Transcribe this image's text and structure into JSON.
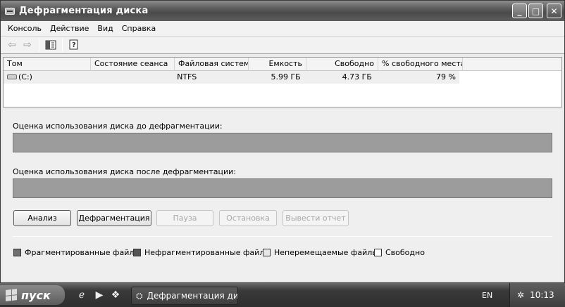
{
  "window": {
    "title": "Дефрагментация диска",
    "buttons": {
      "minimize": "_",
      "maximize": "□",
      "close": "✕"
    }
  },
  "menu": [
    "Консоль",
    "Действие",
    "Вид",
    "Справка"
  ],
  "list": {
    "columns": [
      "Том",
      "Состояние сеанса",
      "Файловая система",
      "Емкость",
      "Свободно",
      "% свободного места"
    ],
    "rows": [
      {
        "volume": "(C:)",
        "status": "",
        "fs": "NTFS",
        "capacity": "5.99 ГБ",
        "free": "4.73 ГБ",
        "free_pct": "79 %"
      }
    ]
  },
  "analysis": {
    "before_label": "Оценка использования диска до дефрагментации:",
    "after_label": "Оценка использования диска после дефрагментации:"
  },
  "buttons": {
    "analyze": "Анализ",
    "defrag": "Дефрагментация",
    "pause": "Пауза",
    "stop": "Остановка",
    "report": "Вывести отчет"
  },
  "legend": {
    "fragmented": "Фрагментированные файлы",
    "contiguous": "Нефрагментированные файлы",
    "unmovable": "Неперемещаемые файлы",
    "free": "Свободно"
  },
  "colors": {
    "fragmented": "#6f6f6f",
    "contiguous": "#555555",
    "unmovable": "#e6e6e6",
    "free": "#ffffff"
  },
  "taskbar": {
    "start": "пуск",
    "task_label": "Дефрагментация ди...",
    "lang": "EN",
    "clock": "10:13"
  }
}
